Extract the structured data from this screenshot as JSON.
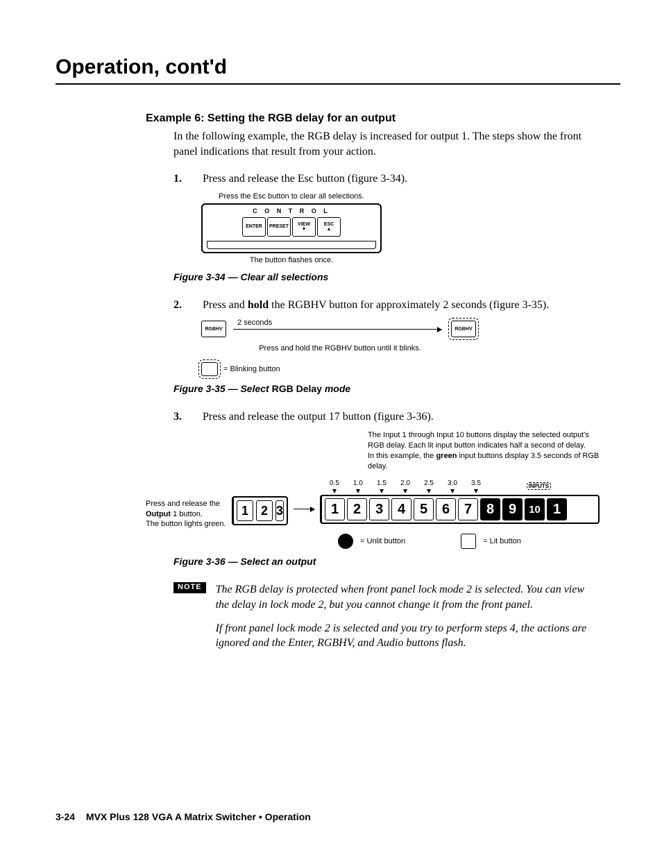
{
  "page_title": "Operation, cont'd",
  "section_heading": "Example 6: Setting the RGB delay for an output",
  "intro_para": "In the following example, the RGB delay is increased for output 1.  The steps show the front panel indications that result from your action.",
  "steps": {
    "s1_num": "1.",
    "s1_txt": "Press and release the Esc button (figure 3-34).",
    "s2_num": "2.",
    "s2_txt_pre": "Press and ",
    "s2_txt_bold": "hold",
    "s2_txt_post": " the RGBHV button for approximately 2 seconds (figure 3-35).",
    "s3_num": "3.",
    "s3_txt": "Press and release the output 17 button (figure 3-36)."
  },
  "fig34": {
    "top_label": "Press the Esc button to clear all selections.",
    "control": "C O N T R O L",
    "btn_enter": "ENTER",
    "btn_preset": "PRESET",
    "btn_view": "VIEW",
    "btn_view_arrow": "▼",
    "btn_esc": "ESC",
    "btn_esc_arrow": "▲",
    "bottom_label": "The button flashes once.",
    "caption": "Figure 3-34 — Clear all selections"
  },
  "fig35": {
    "rgbhv": "RGBHV",
    "two_seconds": "2 seconds",
    "under": "Press and hold the RGBHV button until it blinks.",
    "legend": "= Blinking button",
    "caption_pre": "Figure 3-35 — Select ",
    "caption_bold": "RGB Delay",
    "caption_post": " mode"
  },
  "fig36": {
    "upper1": "The Input 1 through Input 10 buttons display the selected output's RGB delay.  Each lit input button indicates half a second of delay.",
    "upper2_pre": "In this example, the ",
    "upper2_bold": "green",
    "upper2_post": " input buttons display 3.5 seconds of RGB delay.",
    "left1": "Press and release the",
    "left2_pre": "",
    "left2_bold": "Output",
    "left2_post": " 1 button.",
    "left3": "The button lights green.",
    "panel_small": [
      "1",
      "2",
      "3"
    ],
    "ticks": [
      "0.5",
      "1.0",
      "1.5",
      "2.0",
      "2.5",
      "3.0",
      "3.5"
    ],
    "inputs_label": "INPUTS",
    "big_buttons": [
      {
        "n": "1",
        "lit": true
      },
      {
        "n": "2",
        "lit": true
      },
      {
        "n": "3",
        "lit": true
      },
      {
        "n": "4",
        "lit": true
      },
      {
        "n": "5",
        "lit": true
      },
      {
        "n": "6",
        "lit": true
      },
      {
        "n": "7",
        "lit": true
      },
      {
        "n": "8",
        "lit": false
      },
      {
        "n": "9",
        "lit": false
      },
      {
        "n": "10",
        "lit": false
      },
      {
        "n": "1",
        "lit": false
      }
    ],
    "legend_unlit": "= Unlit button",
    "legend_lit": "= Lit button",
    "caption": "Figure 3-36 — Select an output"
  },
  "note": {
    "badge": "NOTE",
    "p1": "The RGB delay is protected when front panel lock mode 2 is selected.  You can view the delay in lock mode 2, but you cannot change it from the front panel.",
    "p2": "If front panel lock mode 2 is selected and you try to perform steps 4, the actions are ignored and the Enter, RGBHV, and Audio buttons flash."
  },
  "footer": {
    "page_num": "3-24",
    "title": "MVX Plus 128 VGA A Matrix Switcher • Operation"
  }
}
